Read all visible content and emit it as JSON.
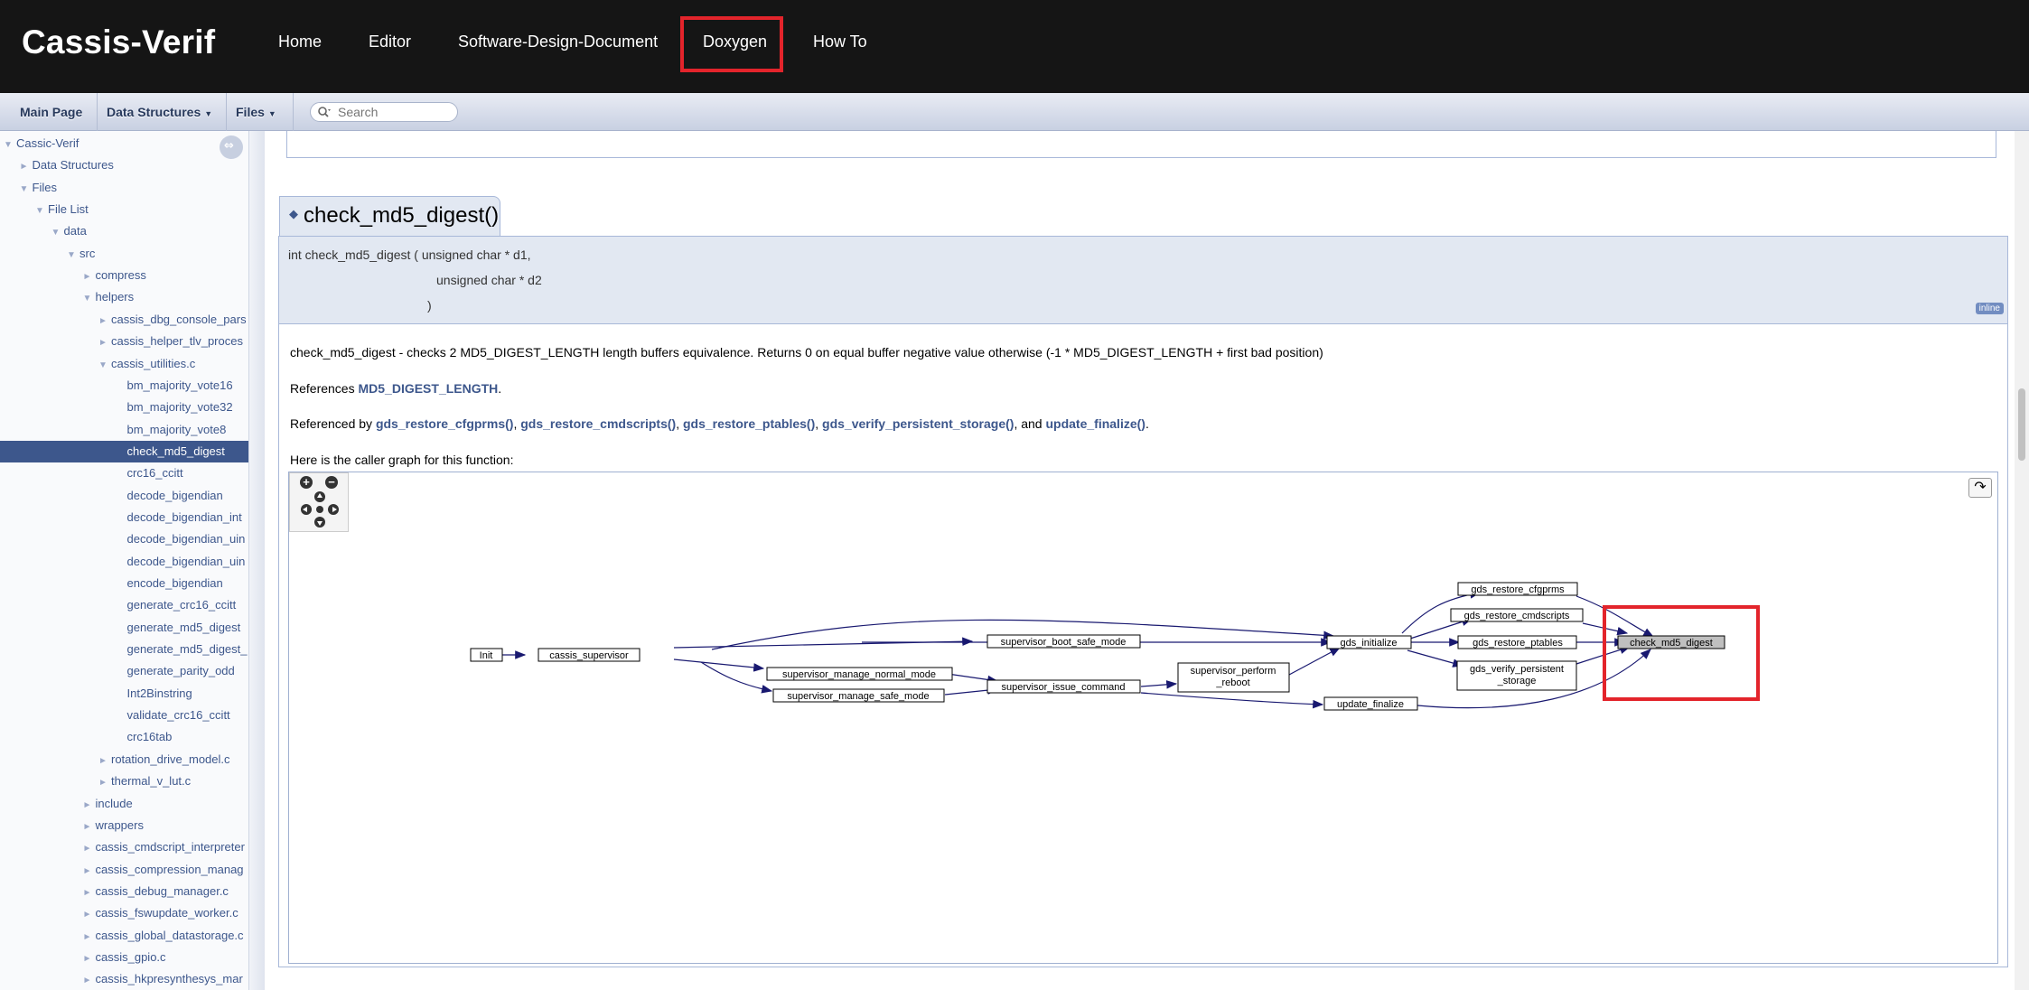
{
  "site": {
    "brand": "Cassis-Verif",
    "nav": [
      "Home",
      "Editor",
      "Software-Design-Document",
      "Doxygen",
      "How To"
    ],
    "active_nav": "Doxygen",
    "highlight_color": "#e3242b"
  },
  "tabs": {
    "main_page": "Main Page",
    "data_structures": "Data Structures",
    "files": "Files",
    "search_placeholder": "Search"
  },
  "sidebar": {
    "rows": [
      {
        "label": "Cassic-Verif",
        "arrow": "▼"
      },
      {
        "label": "Data Structures",
        "arrow": "►"
      },
      {
        "label": "Files",
        "arrow": "▼"
      },
      {
        "label": "File List",
        "arrow": "▼"
      },
      {
        "label": "data",
        "arrow": "▼"
      },
      {
        "label": "src",
        "arrow": "▼"
      },
      {
        "label": "compress",
        "arrow": "►"
      },
      {
        "label": "helpers",
        "arrow": "▼"
      },
      {
        "label": "cassis_dbg_console_pars",
        "arrow": "►"
      },
      {
        "label": "cassis_helper_tlv_proces",
        "arrow": "►"
      },
      {
        "label": "cassis_utilities.c",
        "arrow": "▼"
      },
      {
        "label": "bm_majority_vote16",
        "arrow": ""
      },
      {
        "label": "bm_majority_vote32",
        "arrow": ""
      },
      {
        "label": "bm_majority_vote8",
        "arrow": ""
      },
      {
        "label": "check_md5_digest",
        "arrow": "",
        "selected": true
      },
      {
        "label": "crc16_ccitt",
        "arrow": ""
      },
      {
        "label": "decode_bigendian",
        "arrow": ""
      },
      {
        "label": "decode_bigendian_int",
        "arrow": ""
      },
      {
        "label": "decode_bigendian_uin",
        "arrow": ""
      },
      {
        "label": "decode_bigendian_uin",
        "arrow": ""
      },
      {
        "label": "encode_bigendian",
        "arrow": ""
      },
      {
        "label": "generate_crc16_ccitt",
        "arrow": ""
      },
      {
        "label": "generate_md5_digest",
        "arrow": ""
      },
      {
        "label": "generate_md5_digest_",
        "arrow": ""
      },
      {
        "label": "generate_parity_odd",
        "arrow": ""
      },
      {
        "label": "Int2Binstring",
        "arrow": ""
      },
      {
        "label": "validate_crc16_ccitt",
        "arrow": ""
      },
      {
        "label": "crc16tab",
        "arrow": ""
      },
      {
        "label": "rotation_drive_model.c",
        "arrow": "►"
      },
      {
        "label": "thermal_v_lut.c",
        "arrow": "►"
      },
      {
        "label": "include",
        "arrow": "►"
      },
      {
        "label": "wrappers",
        "arrow": "►"
      },
      {
        "label": "cassis_cmdscript_interpreter",
        "arrow": "►"
      },
      {
        "label": "cassis_compression_manag",
        "arrow": "►"
      },
      {
        "label": "cassis_debug_manager.c",
        "arrow": "►"
      },
      {
        "label": "cassis_fswupdate_worker.c",
        "arrow": "►"
      },
      {
        "label": "cassis_global_datastorage.c",
        "arrow": "►"
      },
      {
        "label": "cassis_gpio.c",
        "arrow": "►"
      },
      {
        "label": "cassis_hkpresynthesys_mar",
        "arrow": "►"
      }
    ]
  },
  "member": {
    "title": "check_md5_digest()",
    "proto_line1": "int check_md5_digest ( unsigned char *  d1,",
    "proto_line2": "unsigned char *  d2",
    "proto_line3": ")",
    "badge": "inline",
    "description": "check_md5_digest - checks 2 MD5_DIGEST_LENGTH length buffers equivalence. Returns 0 on equal buffer negative value otherwise (-1 * MD5_DIGEST_LENGTH + first bad position)",
    "references_prefix": "References ",
    "references_link": "MD5_DIGEST_LENGTH",
    "references_suffix": ".",
    "referenced_prefix": "Referenced by ",
    "referenced_links": [
      "gds_restore_cfgprms()",
      "gds_restore_cmdscripts()",
      "gds_restore_ptables()",
      "gds_verify_persistent_storage()",
      "update_finalize()"
    ],
    "referenced_and": "and",
    "caller_graph_label": "Here is the caller graph for this function:"
  },
  "graph": {
    "nodes": {
      "init": "Init",
      "cassis_supervisor": "cassis_supervisor",
      "boot_safe": "supervisor_boot_safe_mode",
      "normal_mode": "supervisor_manage_normal_mode",
      "safe_mode": "supervisor_manage_safe_mode",
      "issue_command": "supervisor_issue_command",
      "perform_reboot_1": "supervisor_perform",
      "perform_reboot_2": "_reboot",
      "gds_initialize": "gds_initialize",
      "update_finalize": "update_finalize",
      "cfgprms": "gds_restore_cfgprms",
      "cmdscripts": "gds_restore_cmdscripts",
      "ptables": "gds_restore_ptables",
      "verify_1": "gds_verify_persistent",
      "verify_2": "_storage",
      "target": "check_md5_digest"
    }
  }
}
